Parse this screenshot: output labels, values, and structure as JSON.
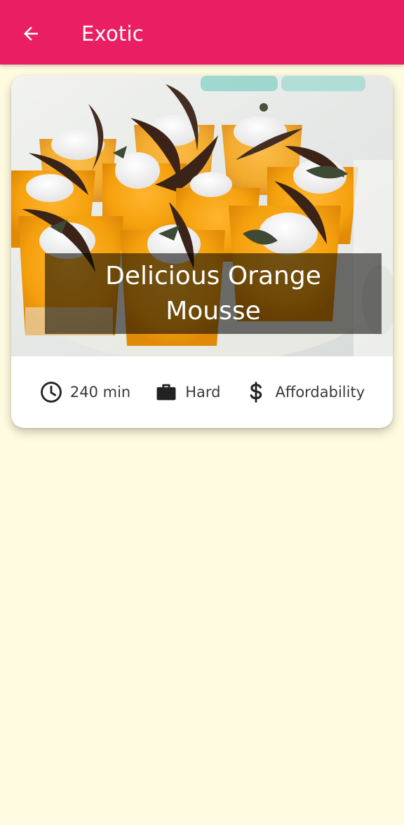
{
  "appbar": {
    "title": "Exotic",
    "back_icon": "arrow-left-icon"
  },
  "meal": {
    "title": "Delicious Orange Mousse",
    "image_alt": "Orange mousse cups with cream and chocolate",
    "duration": "240 min",
    "complexity": "Hard",
    "affordability": "Affordability",
    "icons": {
      "duration": "clock-icon",
      "complexity": "briefcase-icon",
      "affordability": "dollar-icon"
    }
  },
  "colors": {
    "primary": "#E91E63",
    "background": "#FFFBE0",
    "card": "#FFFFFF",
    "overlay": "rgba(0,0,0,0.55)"
  }
}
